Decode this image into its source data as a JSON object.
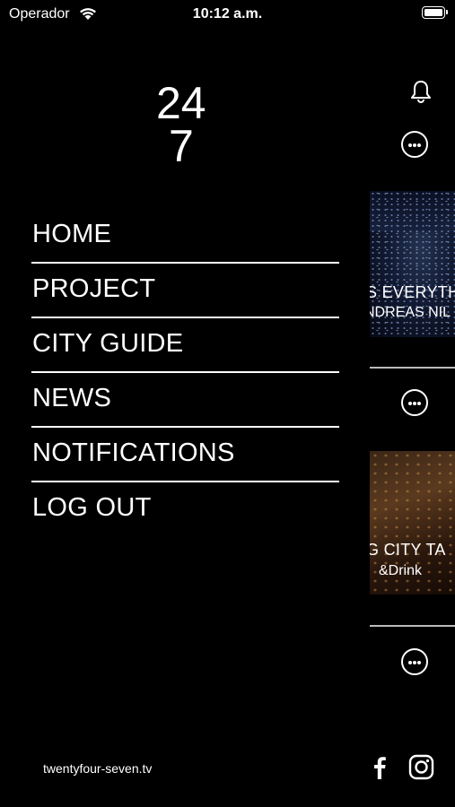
{
  "status_bar": {
    "carrier": "Operador",
    "time": "10:12 a.m."
  },
  "logo": {
    "text_top": "24",
    "text_bottom": "7"
  },
  "menu": {
    "items": [
      {
        "label": "HOME"
      },
      {
        "label": "PROJECT"
      },
      {
        "label": "CITY GUIDE"
      },
      {
        "label": "NEWS"
      },
      {
        "label": "NOTIFICATIONS"
      },
      {
        "label": "LOG OUT"
      }
    ]
  },
  "footer": {
    "website": "twentyfour-seven.tv",
    "social_icons": [
      "facebook-icon",
      "instagram-icon"
    ]
  },
  "background_feed": {
    "cards": [
      {
        "title": "S EVERYTH",
        "subtitle": "NDREAS NIL"
      },
      {
        "title": "G CITY TA",
        "subtitle": "&Drink"
      }
    ],
    "icons": [
      "bell-icon",
      "more-icon"
    ]
  }
}
